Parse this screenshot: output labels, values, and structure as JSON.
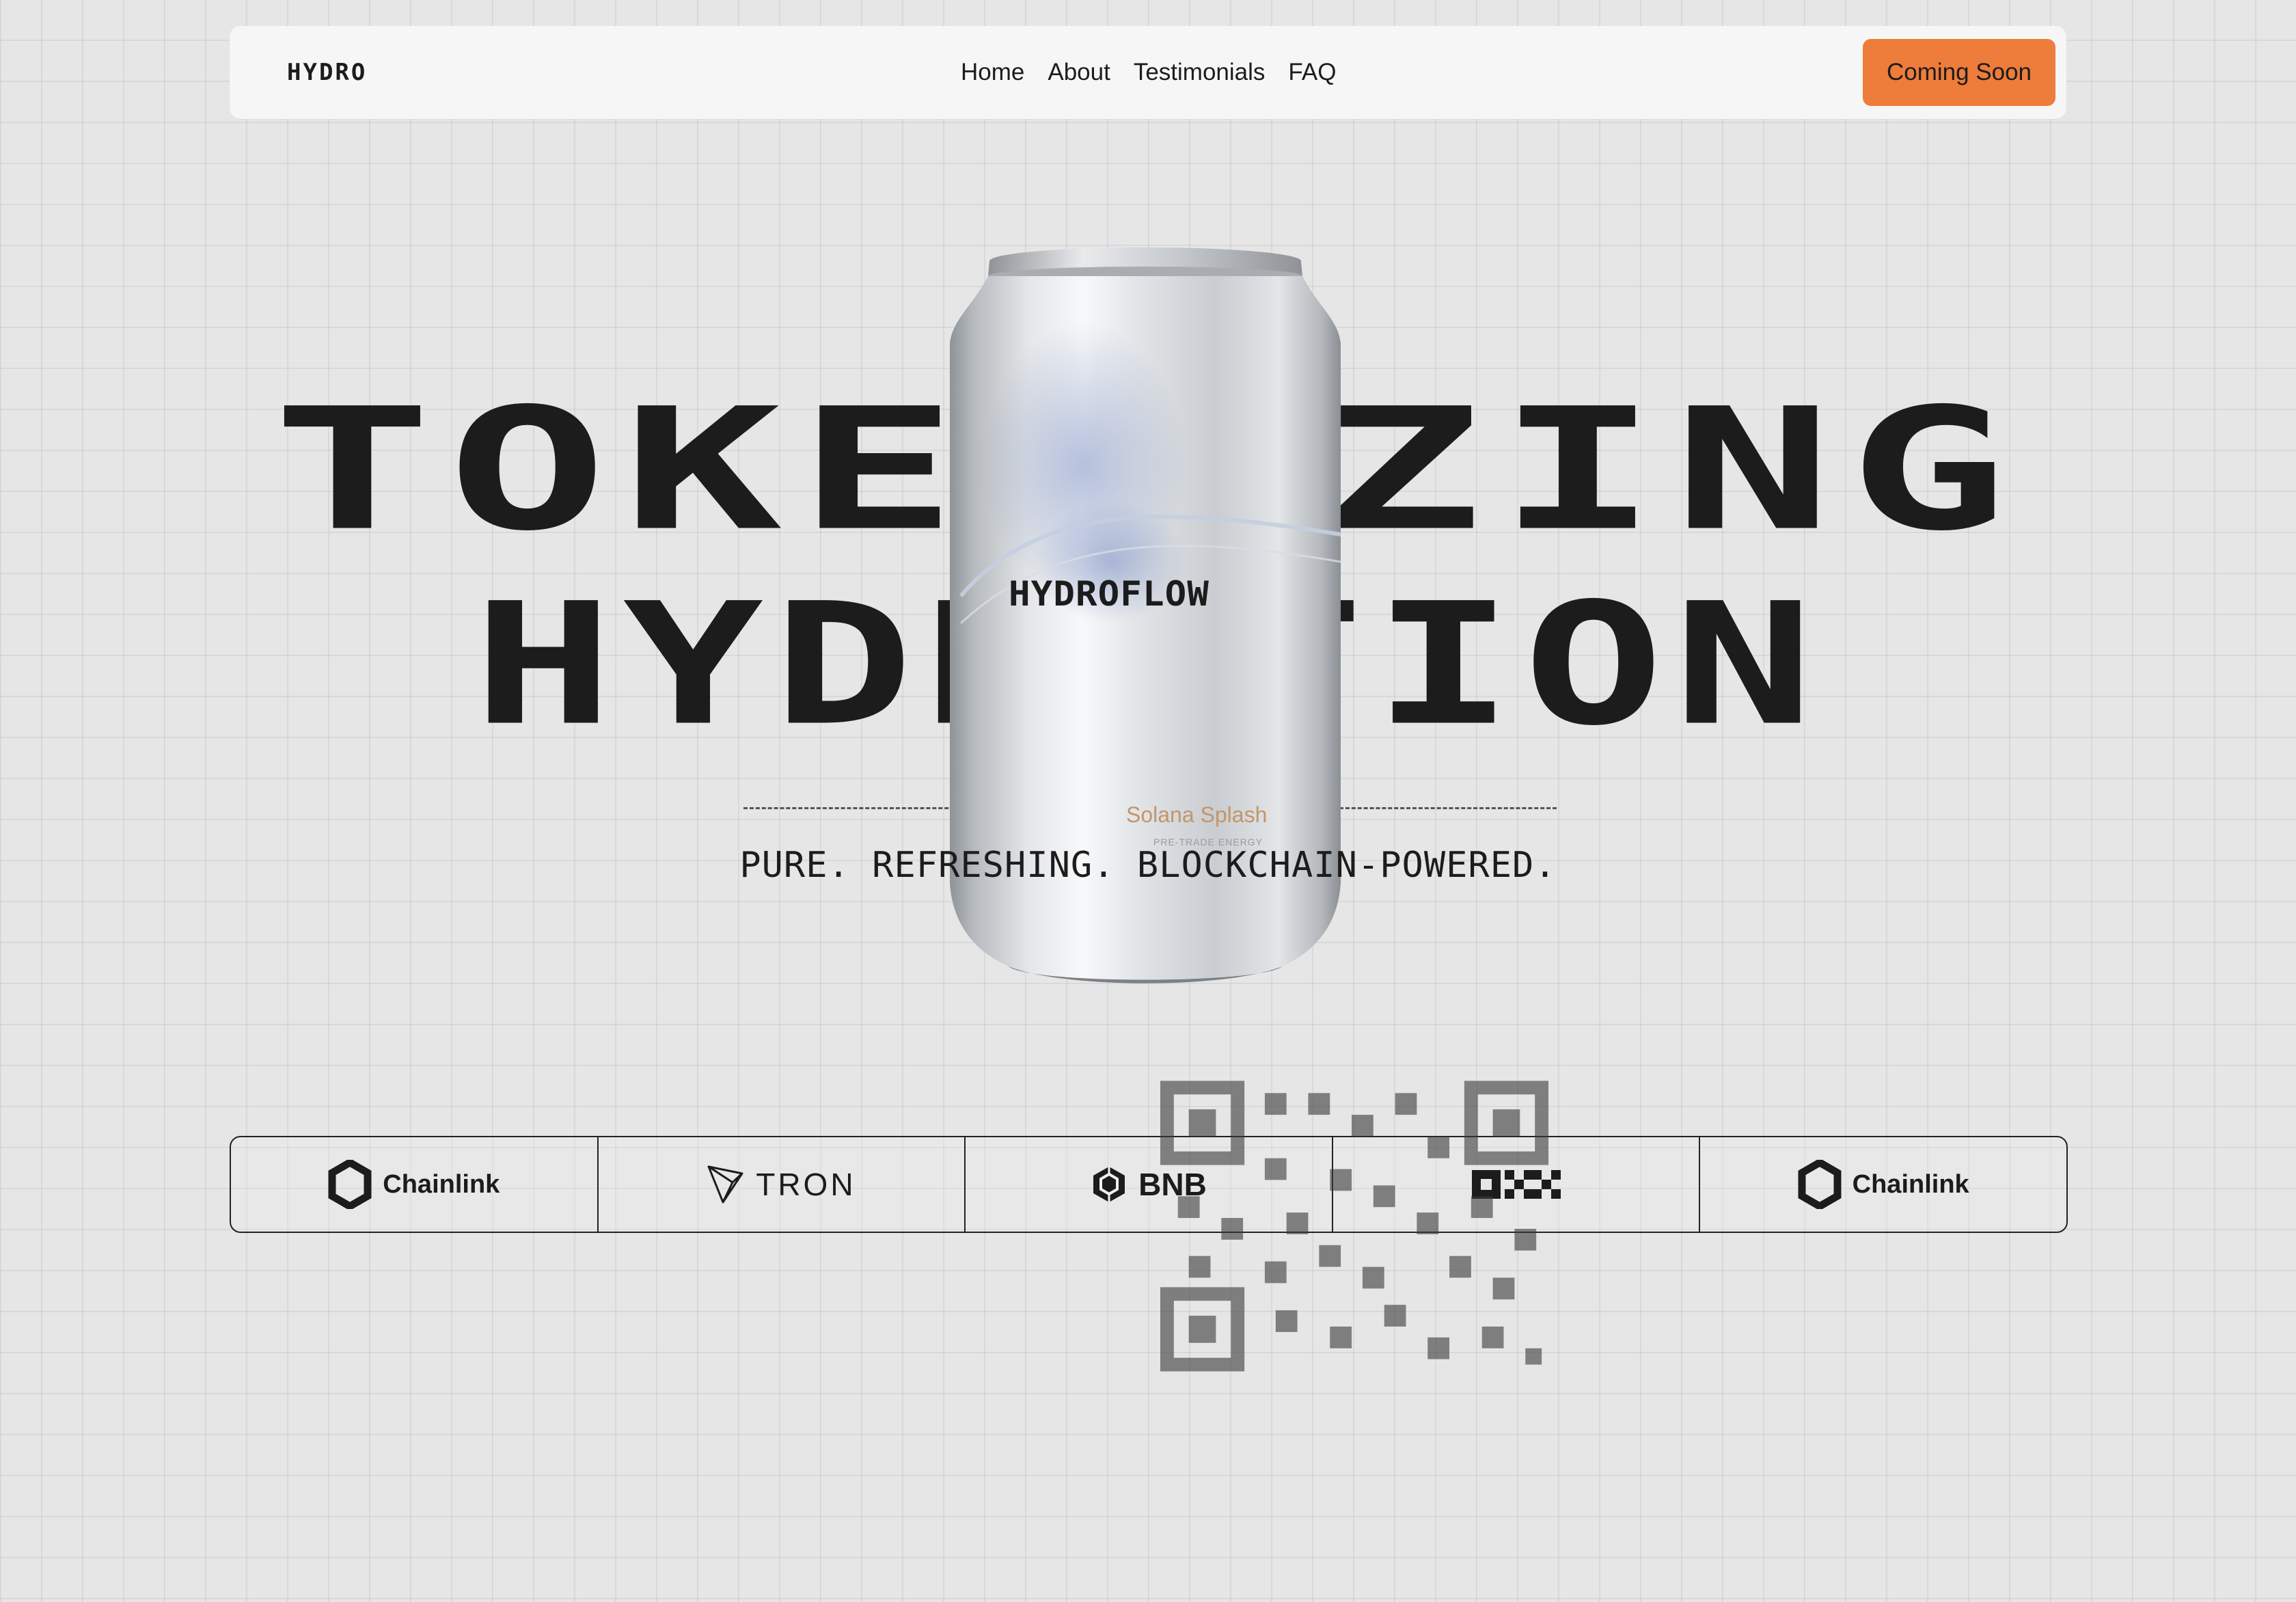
{
  "navbar": {
    "logo": "HYDRO",
    "links": [
      "Home",
      "About",
      "Testimonials",
      "FAQ"
    ],
    "cta_label": "Coming Soon"
  },
  "hero": {
    "line1": "TOKENIZING",
    "line2": "HYDRATION",
    "tagline": "PURE. REFRESHING. BLOCKCHAIN-POWERED."
  },
  "can": {
    "brand": "HYDROFLOW",
    "flavor": "Solana Splash",
    "subtitle": "PRE-TRADE ENERGY"
  },
  "partners": [
    {
      "name": "Chainlink",
      "icon": "chainlink-icon"
    },
    {
      "name": "TRON",
      "icon": "tron-icon"
    },
    {
      "name": "BNB",
      "icon": "bnb-icon"
    },
    {
      "name": "",
      "icon": "okx-logo"
    },
    {
      "name": "Chainlink",
      "icon": "chainlink-icon"
    }
  ],
  "colors": {
    "accent": "#ee7c3a",
    "background": "#e6e6e6",
    "text": "#1c1c1c",
    "can_flavor": "#c4956a"
  }
}
